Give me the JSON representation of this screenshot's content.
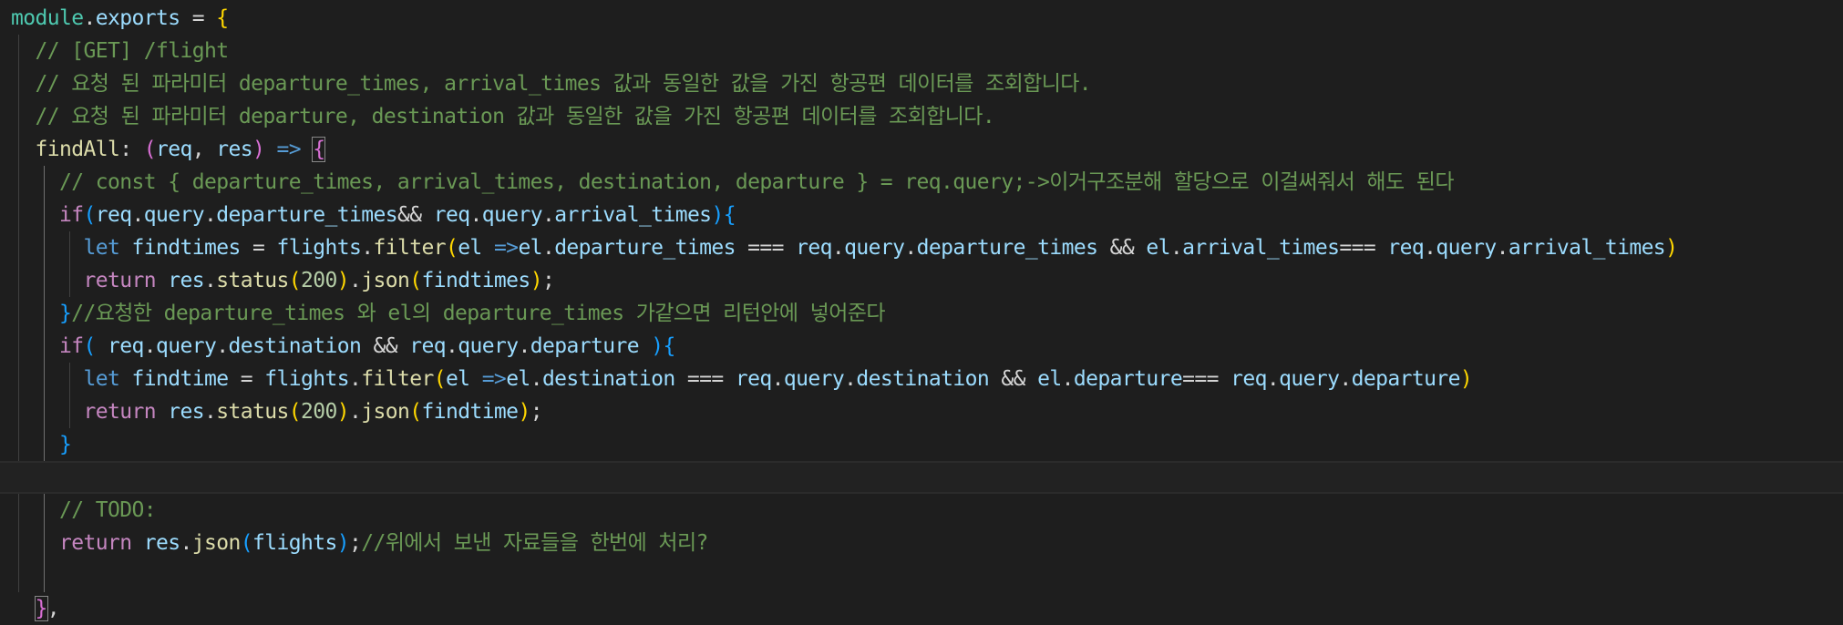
{
  "editor": {
    "colors": {
      "background": "#1e1e1e",
      "keyword": "#569cd6",
      "control": "#c586c0",
      "variable": "#9cdcfe",
      "function": "#dcdcaa",
      "number": "#b5cea8",
      "comment": "#6a9955",
      "bracket_level1": "#ffd700",
      "bracket_level2": "#da70d6",
      "bracket_level3": "#179fff"
    },
    "lines": [
      [
        [
          "obj",
          "module"
        ],
        [
          "pl",
          "."
        ],
        [
          "var",
          "exports"
        ],
        [
          "pl",
          " = "
        ],
        [
          "b1",
          "{"
        ]
      ],
      [
        [
          "pl",
          "  "
        ],
        [
          "cm",
          "// [GET] /flight"
        ]
      ],
      [
        [
          "pl",
          "  "
        ],
        [
          "cm",
          "// 요청 된 파라미터 departure_times, arrival_times 값과 동일한 값을 가진 항공편 데이터를 조회합니다."
        ]
      ],
      [
        [
          "pl",
          "  "
        ],
        [
          "cm",
          "// 요청 된 파라미터 departure, destination 값과 동일한 값을 가진 항공편 데이터를 조회합니다."
        ]
      ],
      [
        [
          "pl",
          "  "
        ],
        [
          "fn",
          "findAll"
        ],
        [
          "pl",
          ": "
        ],
        [
          "b2",
          "("
        ],
        [
          "var",
          "req"
        ],
        [
          "pl",
          ", "
        ],
        [
          "var",
          "res"
        ],
        [
          "b2",
          ")"
        ],
        [
          "pl",
          " "
        ],
        [
          "kw",
          "=>"
        ],
        [
          "pl",
          " "
        ],
        [
          "b2m",
          "{"
        ]
      ],
      [
        [
          "pl",
          "    "
        ],
        [
          "cm",
          "// const { departure_times, arrival_times, destination, departure } = req.query;->이거구조분해 할당으로 이걸써줘서 해도 된다"
        ]
      ],
      [
        [
          "pl",
          "    "
        ],
        [
          "ctl",
          "if"
        ],
        [
          "b3",
          "("
        ],
        [
          "var",
          "req"
        ],
        [
          "pl",
          "."
        ],
        [
          "var",
          "query"
        ],
        [
          "pl",
          "."
        ],
        [
          "var",
          "departure_times"
        ],
        [
          "pl",
          "&& "
        ],
        [
          "var",
          "req"
        ],
        [
          "pl",
          "."
        ],
        [
          "var",
          "query"
        ],
        [
          "pl",
          "."
        ],
        [
          "var",
          "arrival_times"
        ],
        [
          "b3",
          ")"
        ],
        [
          "b3",
          "{"
        ]
      ],
      [
        [
          "pl",
          "      "
        ],
        [
          "kw",
          "let"
        ],
        [
          "pl",
          " "
        ],
        [
          "var",
          "findtimes"
        ],
        [
          "pl",
          " = "
        ],
        [
          "var",
          "flights"
        ],
        [
          "pl",
          "."
        ],
        [
          "fn",
          "filter"
        ],
        [
          "b1",
          "("
        ],
        [
          "var",
          "el"
        ],
        [
          "pl",
          " "
        ],
        [
          "kw",
          "=>"
        ],
        [
          "var",
          "el"
        ],
        [
          "pl",
          "."
        ],
        [
          "var",
          "departure_times"
        ],
        [
          "pl",
          " === "
        ],
        [
          "var",
          "req"
        ],
        [
          "pl",
          "."
        ],
        [
          "var",
          "query"
        ],
        [
          "pl",
          "."
        ],
        [
          "var",
          "departure_times"
        ],
        [
          "pl",
          " && "
        ],
        [
          "var",
          "el"
        ],
        [
          "pl",
          "."
        ],
        [
          "var",
          "arrival_times"
        ],
        [
          "pl",
          "=== "
        ],
        [
          "var",
          "req"
        ],
        [
          "pl",
          "."
        ],
        [
          "var",
          "query"
        ],
        [
          "pl",
          "."
        ],
        [
          "var",
          "arrival_times"
        ],
        [
          "b1",
          ")"
        ]
      ],
      [
        [
          "pl",
          "      "
        ],
        [
          "ctl",
          "return"
        ],
        [
          "pl",
          " "
        ],
        [
          "var",
          "res"
        ],
        [
          "pl",
          "."
        ],
        [
          "fn",
          "status"
        ],
        [
          "b1",
          "("
        ],
        [
          "num",
          "200"
        ],
        [
          "b1",
          ")"
        ],
        [
          "pl",
          "."
        ],
        [
          "fn",
          "json"
        ],
        [
          "b1",
          "("
        ],
        [
          "var",
          "findtimes"
        ],
        [
          "b1",
          ")"
        ],
        [
          "pl",
          ";"
        ]
      ],
      [
        [
          "pl",
          "    "
        ],
        [
          "b3",
          "}"
        ],
        [
          "cm",
          "//요청한 departure_times 와 el의 departure_times 가같으면 리턴안에 넣어준다"
        ]
      ],
      [
        [
          "pl",
          "    "
        ],
        [
          "ctl",
          "if"
        ],
        [
          "b3",
          "("
        ],
        [
          "pl",
          " "
        ],
        [
          "var",
          "req"
        ],
        [
          "pl",
          "."
        ],
        [
          "var",
          "query"
        ],
        [
          "pl",
          "."
        ],
        [
          "var",
          "destination"
        ],
        [
          "pl",
          " && "
        ],
        [
          "var",
          "req"
        ],
        [
          "pl",
          "."
        ],
        [
          "var",
          "query"
        ],
        [
          "pl",
          "."
        ],
        [
          "var",
          "departure"
        ],
        [
          "pl",
          " "
        ],
        [
          "b3",
          ")"
        ],
        [
          "b3",
          "{"
        ]
      ],
      [
        [
          "pl",
          "      "
        ],
        [
          "kw",
          "let"
        ],
        [
          "pl",
          " "
        ],
        [
          "var",
          "findtime"
        ],
        [
          "pl",
          " = "
        ],
        [
          "var",
          "flights"
        ],
        [
          "pl",
          "."
        ],
        [
          "fn",
          "filter"
        ],
        [
          "b1",
          "("
        ],
        [
          "var",
          "el"
        ],
        [
          "pl",
          " "
        ],
        [
          "kw",
          "=>"
        ],
        [
          "var",
          "el"
        ],
        [
          "pl",
          "."
        ],
        [
          "var",
          "destination"
        ],
        [
          "pl",
          " === "
        ],
        [
          "var",
          "req"
        ],
        [
          "pl",
          "."
        ],
        [
          "var",
          "query"
        ],
        [
          "pl",
          "."
        ],
        [
          "var",
          "destination"
        ],
        [
          "pl",
          " && "
        ],
        [
          "var",
          "el"
        ],
        [
          "pl",
          "."
        ],
        [
          "var",
          "departure"
        ],
        [
          "pl",
          "=== "
        ],
        [
          "var",
          "req"
        ],
        [
          "pl",
          "."
        ],
        [
          "var",
          "query"
        ],
        [
          "pl",
          "."
        ],
        [
          "var",
          "departure"
        ],
        [
          "b1",
          ")"
        ]
      ],
      [
        [
          "pl",
          "      "
        ],
        [
          "ctl",
          "return"
        ],
        [
          "pl",
          " "
        ],
        [
          "var",
          "res"
        ],
        [
          "pl",
          "."
        ],
        [
          "fn",
          "status"
        ],
        [
          "b1",
          "("
        ],
        [
          "num",
          "200"
        ],
        [
          "b1",
          ")"
        ],
        [
          "pl",
          "."
        ],
        [
          "fn",
          "json"
        ],
        [
          "b1",
          "("
        ],
        [
          "var",
          "findtime"
        ],
        [
          "b1",
          ")"
        ],
        [
          "pl",
          ";"
        ]
      ],
      [
        [
          "pl",
          "    "
        ],
        [
          "b3",
          "}"
        ]
      ],
      [],
      [
        [
          "pl",
          "    "
        ],
        [
          "cm",
          "// TODO:"
        ]
      ],
      [
        [
          "pl",
          "    "
        ],
        [
          "ctl",
          "return"
        ],
        [
          "pl",
          " "
        ],
        [
          "var",
          "res"
        ],
        [
          "pl",
          "."
        ],
        [
          "fn",
          "json"
        ],
        [
          "b3",
          "("
        ],
        [
          "var",
          "flights"
        ],
        [
          "b3",
          ")"
        ],
        [
          "pl",
          ";"
        ],
        [
          "cm",
          "//위에서 보낸 자료들을 한번에 처리?"
        ]
      ],
      [],
      [
        [
          "pl",
          "  "
        ],
        [
          "b2m",
          "}"
        ],
        [
          "pl",
          ","
        ]
      ]
    ]
  }
}
